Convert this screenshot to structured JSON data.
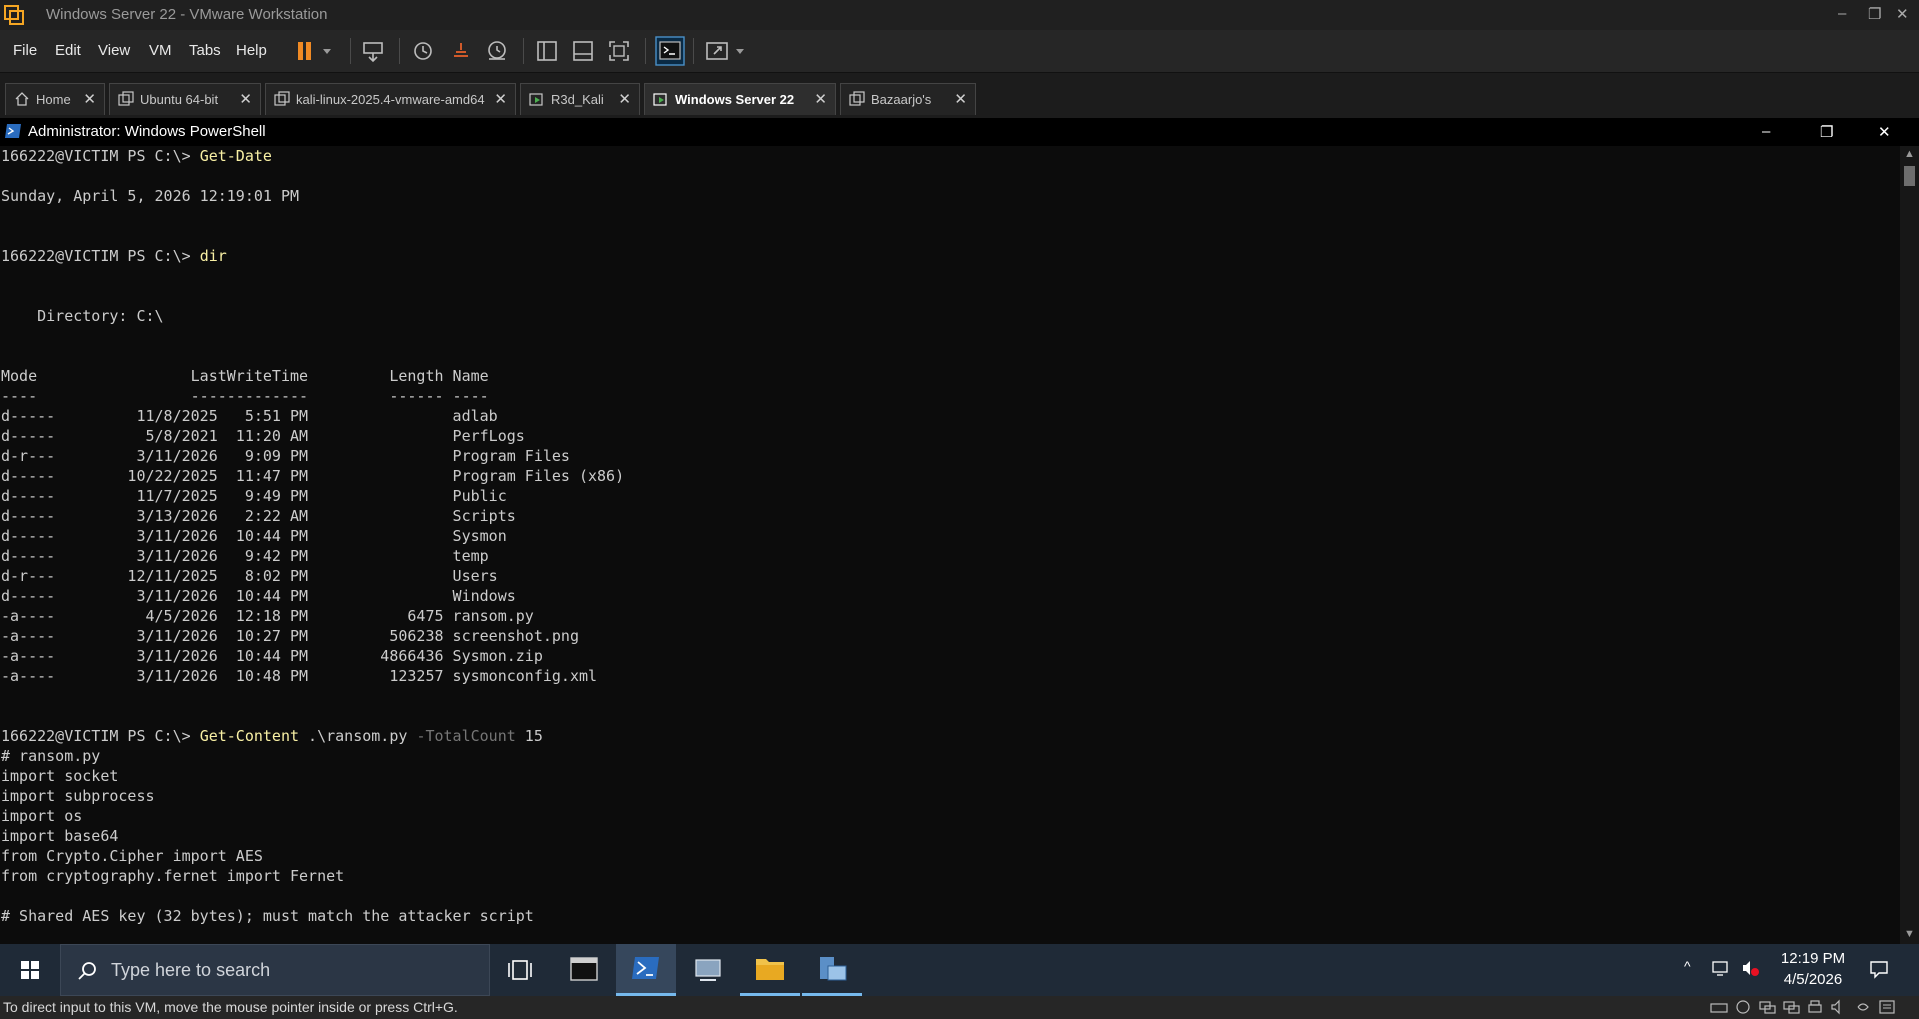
{
  "window": {
    "title": "Windows Server 22 - VMware Workstation",
    "minimize": "–",
    "restore": "❐",
    "close": "✕"
  },
  "menu": [
    "File",
    "Edit",
    "View",
    "VM",
    "Tabs",
    "Help"
  ],
  "tabs": [
    {
      "label": "Home",
      "icon": "home-icon"
    },
    {
      "label": "Ubuntu 64-bit",
      "icon": "vm-icon"
    },
    {
      "label": "kali-linux-2025.4-vmware-amd64",
      "icon": "vm-icon"
    },
    {
      "label": "R3d_Kali",
      "icon": "vm-running-icon"
    },
    {
      "label": "Windows Server 22",
      "icon": "vm-running-icon",
      "active": true
    },
    {
      "label": "Bazaarjo's",
      "icon": "vm-icon"
    }
  ],
  "tab_close": "✕",
  "powershell": {
    "title": "Administrator: Windows PowerShell",
    "minimize": "–",
    "restore": "❐",
    "close": "✕"
  },
  "console": {
    "prompt": "166222@VICTIM PS C:\\> ",
    "cmd1": "Get-Date",
    "date_output": "Sunday, April 5, 2026 12:19:01 PM",
    "cmd2": "dir",
    "directory_line": "    Directory: C:\\",
    "header_line": "Mode                 LastWriteTime         Length Name",
    "header_underline": "----                 -------------         ------ ----",
    "dir_rows": [
      "d-----         11/8/2025   5:51 PM                adlab",
      "d-----          5/8/2021  11:20 AM                PerfLogs",
      "d-r---         3/11/2026   9:09 PM                Program Files",
      "d-----        10/22/2025  11:47 PM                Program Files (x86)",
      "d-----         11/7/2025   9:49 PM                Public",
      "d-----         3/13/2026   2:22 AM                Scripts",
      "d-----         3/11/2026  10:44 PM                Sysmon",
      "d-----         3/11/2026   9:42 PM                temp",
      "d-r---        12/11/2025   8:02 PM                Users",
      "d-----         3/11/2026  10:44 PM                Windows",
      "-a----          4/5/2026  12:18 PM           6475 ransom.py",
      "-a----         3/11/2026  10:27 PM         506238 screenshot.png",
      "-a----         3/11/2026  10:44 PM        4866436 Sysmon.zip",
      "-a----         3/11/2026  10:48 PM         123257 sysmonconfig.xml"
    ],
    "cmd3": "Get-Content",
    "cmd3_arg": " .\\ransom.py ",
    "cmd3_param": "-TotalCount",
    "cmd3_value": " 15",
    "file_lines": [
      "# ransom.py",
      "import socket",
      "import subprocess",
      "import os",
      "import base64",
      "from Crypto.Cipher import AES",
      "from cryptography.fernet import Fernet",
      "",
      "# Shared AES key (32 bytes); must match the attacker script"
    ]
  },
  "taskbar": {
    "search_placeholder": "Type here to search",
    "time": "12:19 PM",
    "date": "4/5/2026"
  },
  "status": {
    "message": "To direct input to this VM, move the mouse pointer inside or press Ctrl+G."
  },
  "colors": {
    "console_bg": "#0c0c0c",
    "command": "#f9f1a5",
    "parameter": "#767676",
    "pause_orange": "#f08a24",
    "taskbar_accent": "#76b9ed"
  }
}
